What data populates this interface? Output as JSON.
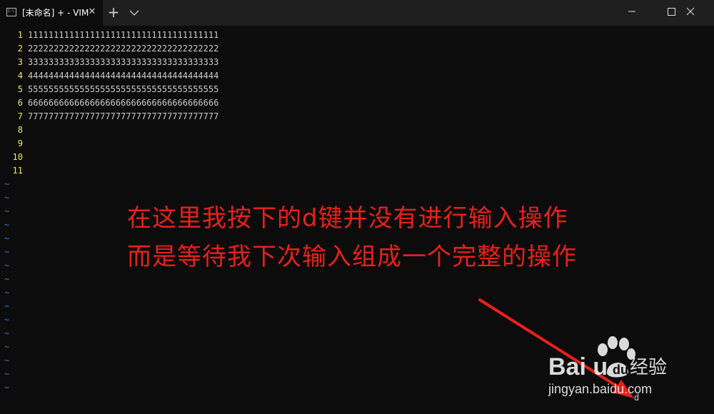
{
  "window": {
    "tab_title": "[未命名] + - VIM",
    "tab_close_glyph": "✕",
    "new_tab_glyph": "+",
    "background_color": "#0c0c0c",
    "titlebar_color": "#1f1f1f"
  },
  "icons": {
    "tab": "terminal-icon",
    "close_tab": "close-icon",
    "new_tab": "plus-icon",
    "dropdown": "chevron-down-icon",
    "minimize": "minimize-icon",
    "maximize": "maximize-icon",
    "close_window": "close-icon"
  },
  "editor": {
    "line_number_color": "#f5e663",
    "text_color": "#cccccc",
    "tilde_color": "#3a78d6",
    "lines": [
      {
        "num": "1",
        "text": "1111111111111111111111111111111111111"
      },
      {
        "num": "2",
        "text": "2222222222222222222222222222222222222"
      },
      {
        "num": "3",
        "text": "3333333333333333333333333333333333333"
      },
      {
        "num": "4",
        "text": "4444444444444444444444444444444444444"
      },
      {
        "num": "5",
        "text": "5555555555555555555555555555555555555"
      },
      {
        "num": "6",
        "text": "6666666666666666666666666666666666666"
      },
      {
        "num": "7",
        "text": "7777777777777777777777777777777777777"
      },
      {
        "num": "8",
        "text": ""
      },
      {
        "num": "9",
        "text": ""
      },
      {
        "num": "10",
        "text": ""
      },
      {
        "num": "11",
        "text": ""
      }
    ],
    "tildes": [
      "~",
      "~",
      "~",
      "~",
      "~",
      "~",
      "~",
      "~",
      "~",
      "~",
      "~",
      "~",
      "~",
      "~",
      "~",
      "~"
    ],
    "pending_key": "d"
  },
  "annotation": {
    "color": "#e8201c",
    "line1": "在这里我按下的d键并没有进行输入操作",
    "line2": "而是等待我下次输入组成一个完整的操作"
  },
  "watermark": {
    "logo": "Bai  u",
    "brand": "经验",
    "url": "jingyan.baidu.com"
  }
}
